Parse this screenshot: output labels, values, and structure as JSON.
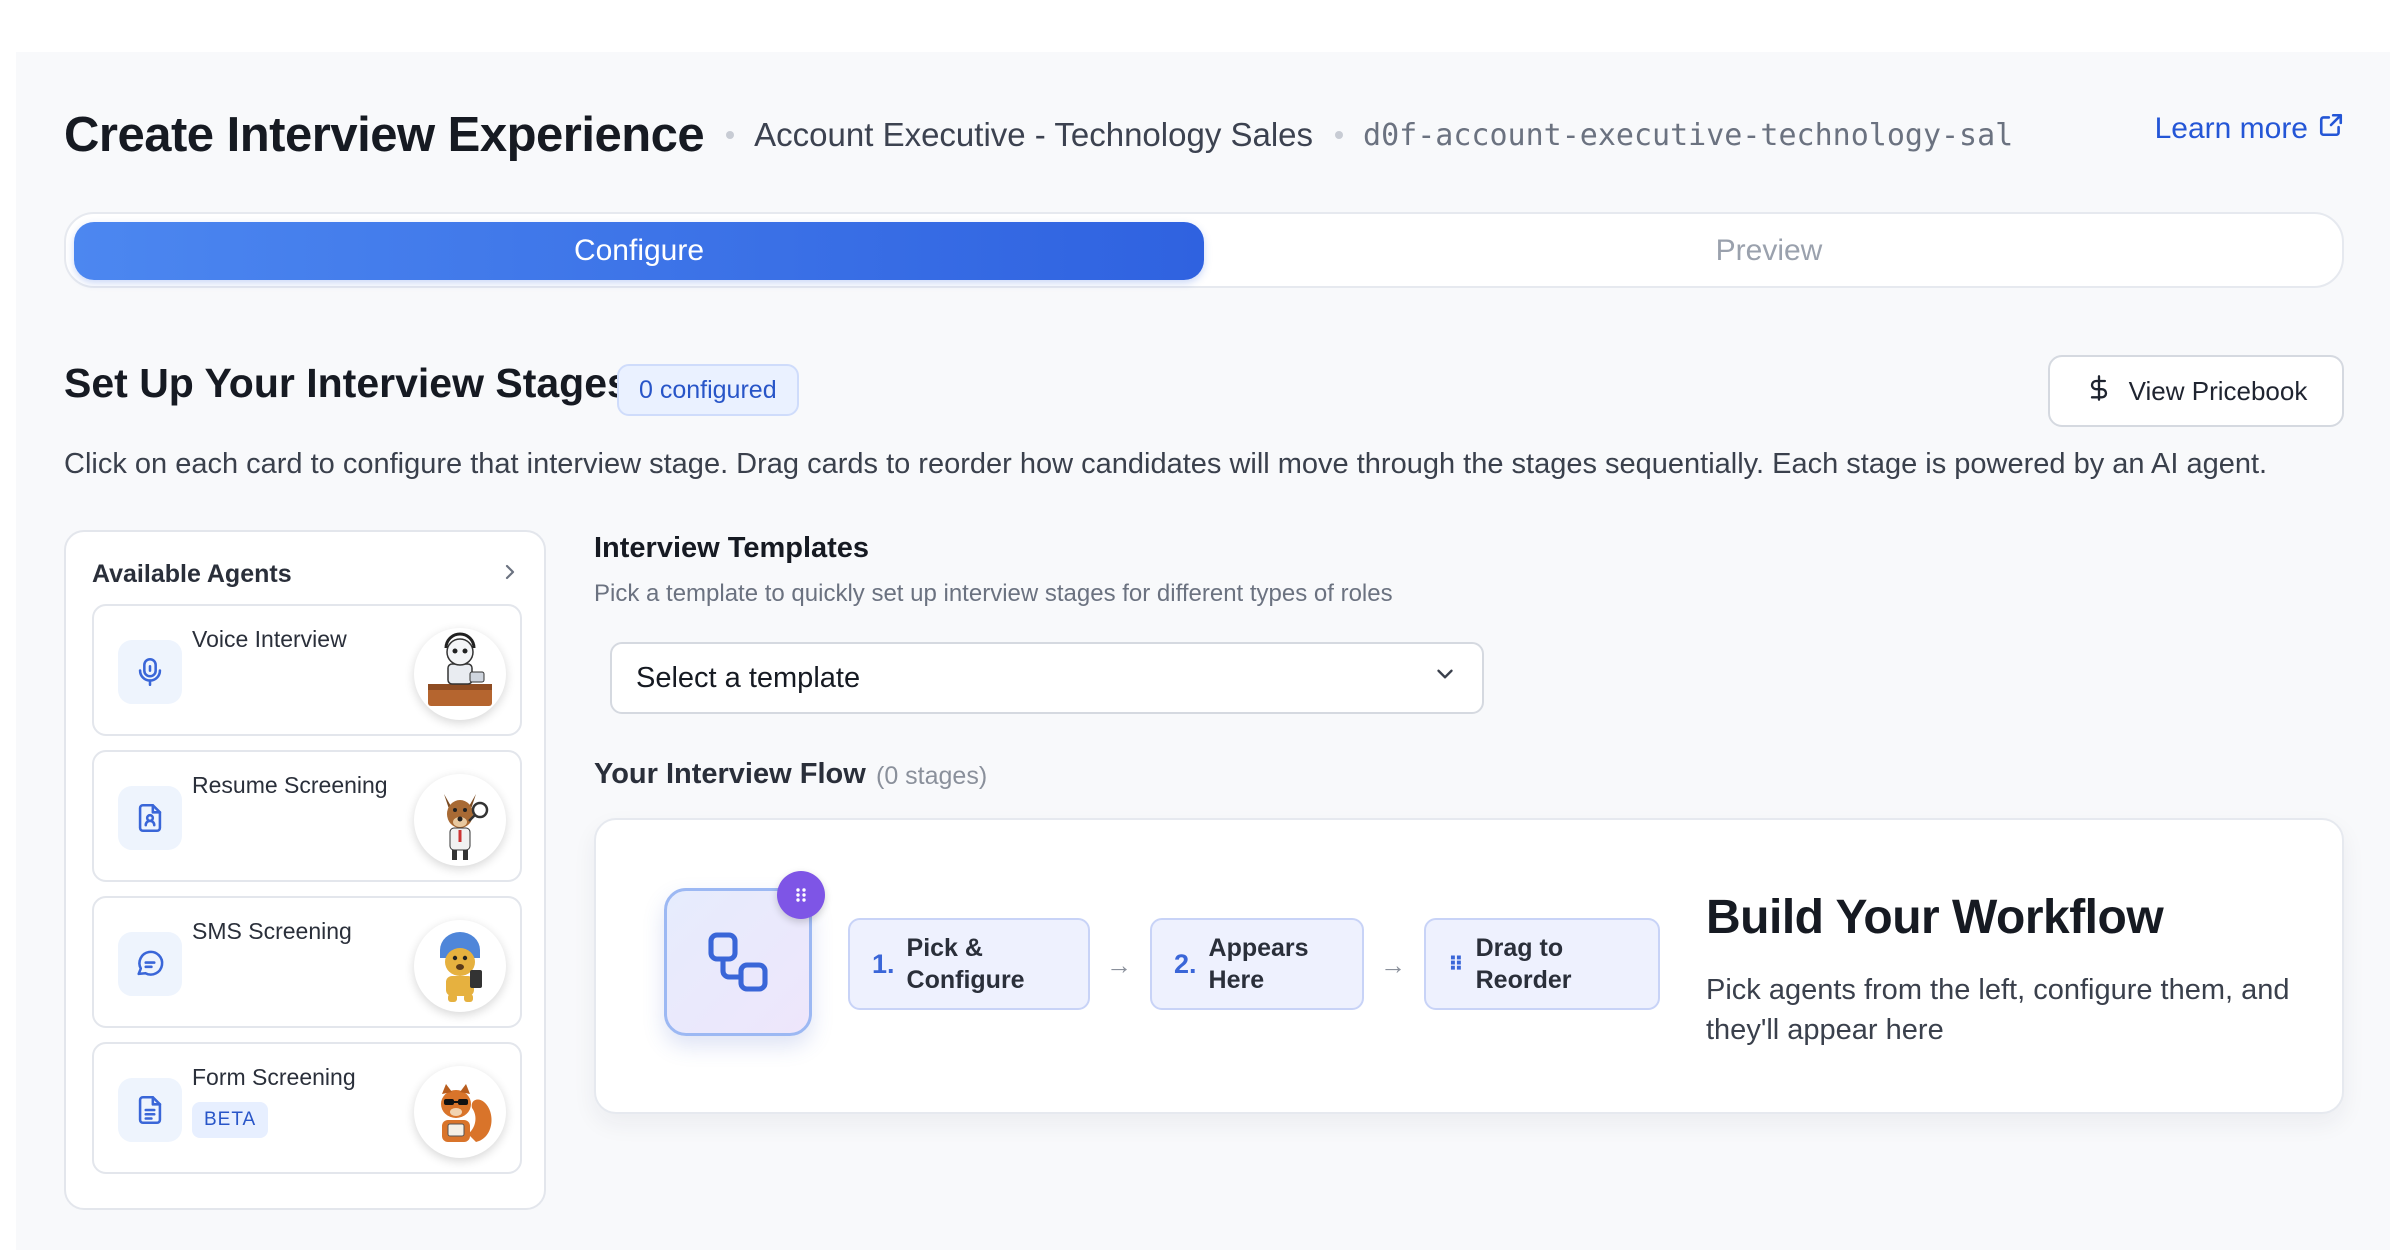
{
  "header": {
    "title": "Create Interview Experience",
    "job_title": "Account Executive - Technology Sales",
    "job_slug": "d0f-account-executive-technology-sal",
    "learn_more": "Learn more"
  },
  "tabs": [
    {
      "label": "Configure",
      "active": true
    },
    {
      "label": "Preview",
      "active": false
    }
  ],
  "stages_section": {
    "title": "Set Up Your Interview Stages",
    "configured_badge": "0 configured",
    "pricebook_button": "View Pricebook",
    "description": "Click on each card to configure that interview stage. Drag cards to reorder how candidates will move through the stages sequentially. Each stage is powered by an AI agent."
  },
  "agents_panel": {
    "title": "Available Agents",
    "agents": [
      {
        "name": "Voice Interview",
        "icon": "microphone-icon",
        "mascot": "robot-at-desk-mascot"
      },
      {
        "name": "Resume Screening",
        "icon": "resume-icon",
        "mascot": "dog-detective-mascot"
      },
      {
        "name": "SMS Screening",
        "icon": "chat-bubble-icon",
        "mascot": "dog-with-phone-mascot"
      },
      {
        "name": "Form Screening",
        "icon": "document-icon",
        "mascot": "squirrel-with-sunglasses-mascot",
        "badge": "BETA"
      }
    ]
  },
  "templates": {
    "title": "Interview Templates",
    "description": "Pick a template to quickly set up interview stages for different types of roles",
    "select_value": "Select a template"
  },
  "flow": {
    "title": "Your Interview Flow",
    "count": "(0 stages)",
    "steps": [
      {
        "num": "1.",
        "text_line1": "Pick &",
        "text_line2": "Configure"
      },
      {
        "num": "2.",
        "text_line1": "Appears",
        "text_line2": "Here"
      },
      {
        "num": "⠿",
        "text_line1": "Drag to",
        "text_line2": "Reorder"
      }
    ],
    "empty_title": "Build Your Workflow",
    "empty_desc": "Pick agents from the left, configure them, and they'll appear here"
  },
  "colors": {
    "accent": "#2f62e0",
    "accent_light": "#4c87f0",
    "link": "#2456d6",
    "drag_badge": "#7e55e6"
  }
}
